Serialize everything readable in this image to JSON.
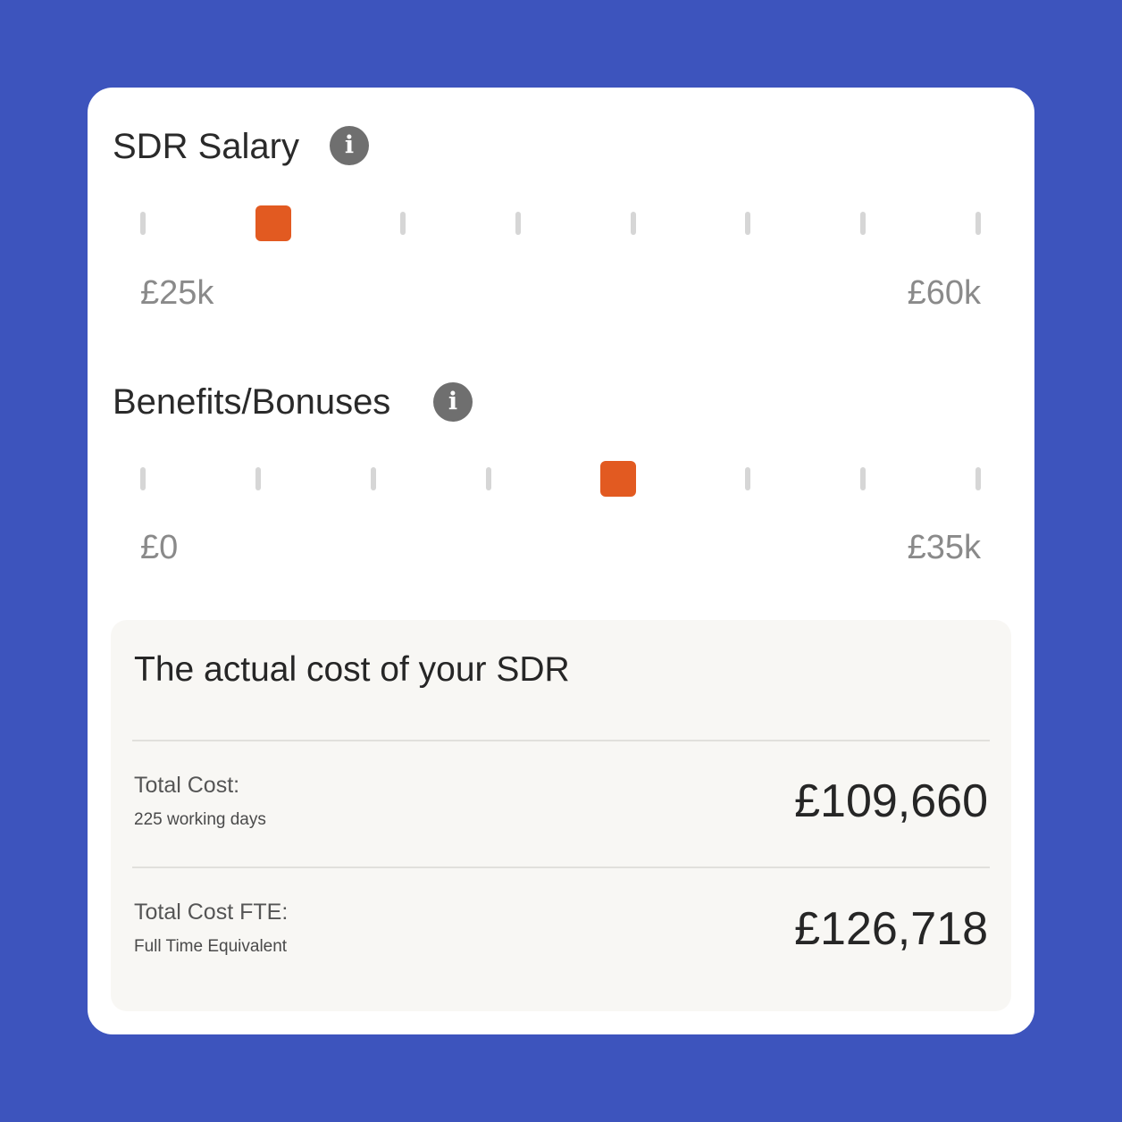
{
  "sliders": [
    {
      "title": "SDR Salary",
      "info_icon": "info-icon",
      "min_label": "£25k",
      "max_label": "£60k",
      "tick_count": 8,
      "selected_index": 1
    },
    {
      "title": "Benefits/Bonuses",
      "info_icon": "info-icon",
      "min_label": "£0",
      "max_label": "£35k",
      "tick_count": 8,
      "selected_index": 4
    }
  ],
  "results": {
    "title": "The actual cost of your SDR",
    "rows": [
      {
        "label": "Total Cost:",
        "sublabel": "225 working days",
        "value": "£109,660"
      },
      {
        "label": "Total Cost FTE:",
        "sublabel": "Full Time Equivalent",
        "value": "£126,718"
      }
    ]
  },
  "colors": {
    "background": "#3d54bd",
    "accent": "#e25a21",
    "tick": "#d6d6d6",
    "panel": "#f8f7f4"
  }
}
